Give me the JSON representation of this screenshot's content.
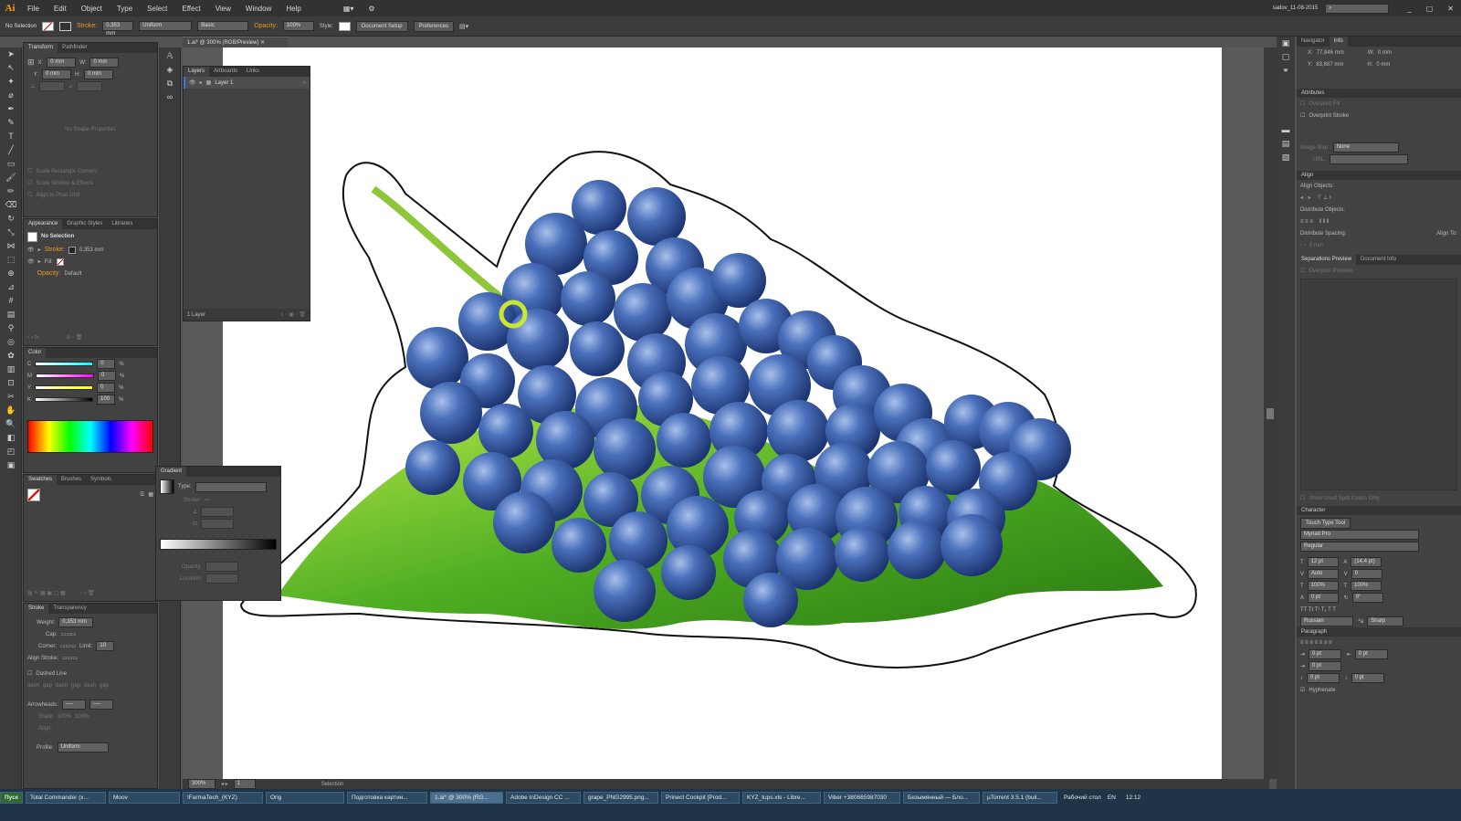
{
  "app": {
    "logo": "Ai",
    "user": "sadov_11-08-2015"
  },
  "menu": [
    "File",
    "Edit",
    "Object",
    "Type",
    "Select",
    "Effect",
    "View",
    "Window",
    "Help"
  ],
  "control": {
    "selection": "No Selection",
    "stroke_label": "Stroke:",
    "stroke_value": "0,353 mm",
    "uniform": "Uniform",
    "basic": "Basic",
    "opacity_label": "Opacity:",
    "opacity_value": "100%",
    "style_label": "Style:",
    "doc_setup": "Document Setup",
    "preferences": "Preferences"
  },
  "document": {
    "tab": "1.ai* @ 300% (RGB/Preview)"
  },
  "transform": {
    "tabs": [
      "Transform",
      "Pathfinder"
    ],
    "x": "0 mm",
    "y": "0 mm",
    "w": "0 mm",
    "h": "0 mm",
    "no_shape": "No Shape Properties",
    "opt1": "Scale Rectangle Corners",
    "opt2": "Scale Strokes & Effects",
    "opt3": "Align to Pixel Grid"
  },
  "appearance": {
    "tabs": [
      "Appearance",
      "Graphic Styles",
      "Libraries"
    ],
    "title": "No Selection",
    "stroke": "Stroke:",
    "stroke_val": "0,353 mm",
    "fill": "Fill:",
    "opacity": "Opacity:",
    "opacity_val": "Default"
  },
  "color": {
    "title": "Color",
    "c": "0",
    "m": "0",
    "y": "0",
    "k": "100",
    "pct": "%"
  },
  "swatches": {
    "tabs": [
      "Swatches",
      "Brushes",
      "Symbols"
    ]
  },
  "stroke_panel": {
    "tabs": [
      "Stroke",
      "Transparency"
    ],
    "weight": "Weight:",
    "weight_val": "0,353 mm",
    "cap": "Cap:",
    "corner": "Corner:",
    "limit": "Limit:",
    "limit_val": "10",
    "align": "Align Stroke:",
    "dashed": "Dashed Line",
    "dash": "dash",
    "gap": "gap",
    "arrowheads": "Arrowheads:",
    "scale": "Scale:",
    "scale_val": "100%",
    "align2": "Align:",
    "profile": "Profile:",
    "profile_val": "Uniform"
  },
  "layers": {
    "tabs": [
      "Layers",
      "Artboards",
      "Links"
    ],
    "layer": "Layer 1",
    "footer": "1 Layer"
  },
  "gradient": {
    "title": "Gradient",
    "type": "Type:",
    "stroke": "Stroke:",
    "opacity": "Opacity:",
    "location": "Location:"
  },
  "right": {
    "nav_tabs": [
      "Navigator",
      "Info"
    ],
    "ix": "77,846 mm",
    "iy": "83,687 mm",
    "iw": "0 mm",
    "ih": "0 mm",
    "attributes": "Attributes",
    "overprint_fill": "Overprint Fill",
    "overprint_stroke": "Overprint Stroke",
    "image_map": "Image Map:",
    "image_map_val": "None",
    "url": "URL:",
    "align": "Align",
    "align_objects": "Align Objects:",
    "distribute_objects": "Distribute Objects:",
    "distribute_spacing": "Distribute Spacing:",
    "align_to": "Align To:",
    "spacing_val": "0 mm",
    "sep_tabs": [
      "Separations Preview",
      "Document Info"
    ],
    "overprint_preview": "Overprint Preview",
    "spot_only": "Show Used Spot Colors Only",
    "character": "Character",
    "touch_type": "Touch Type Tool",
    "font": "Myriad Pro",
    "style": "Regular",
    "size": "12 pt",
    "leading": "(14,4 pt)",
    "kern": "Auto",
    "track": "0",
    "scale_h": "100%",
    "scale_v": "100%",
    "baseline": "0 pt",
    "rotate": "0°",
    "language": "Russian",
    "aa": "Sharp",
    "paragraph": "Paragraph",
    "indent": "0 pt",
    "hyphenate": "Hyphenate"
  },
  "statusbar": {
    "zoom": "300%",
    "page": "1",
    "mode": "Selection"
  },
  "taskbar": {
    "start": "Пуск",
    "items": [
      "Total Commander (x...",
      "Moov",
      "!FarmaTech_(KYZ)",
      "Orig",
      "Подготовка картин...",
      "1.ai* @ 300% (RG...",
      "Adobe InDesign CC ...",
      "grape_PNG2995.png...",
      "Prinect Cockpit [Prod...",
      "KYZ_tups.xls - Libre...",
      "Viber +380665987030",
      "Безымянный — Бло...",
      "µTorrent 3.5.1 (buil..."
    ],
    "desktop": "Рабочий стол",
    "lang": "EN",
    "clock": "12:12"
  },
  "colors": {
    "accent": "#e8962a",
    "bg": "#535353",
    "panel": "#424242",
    "grape": "#3b5ea8",
    "leaf": "#5cb82e"
  }
}
